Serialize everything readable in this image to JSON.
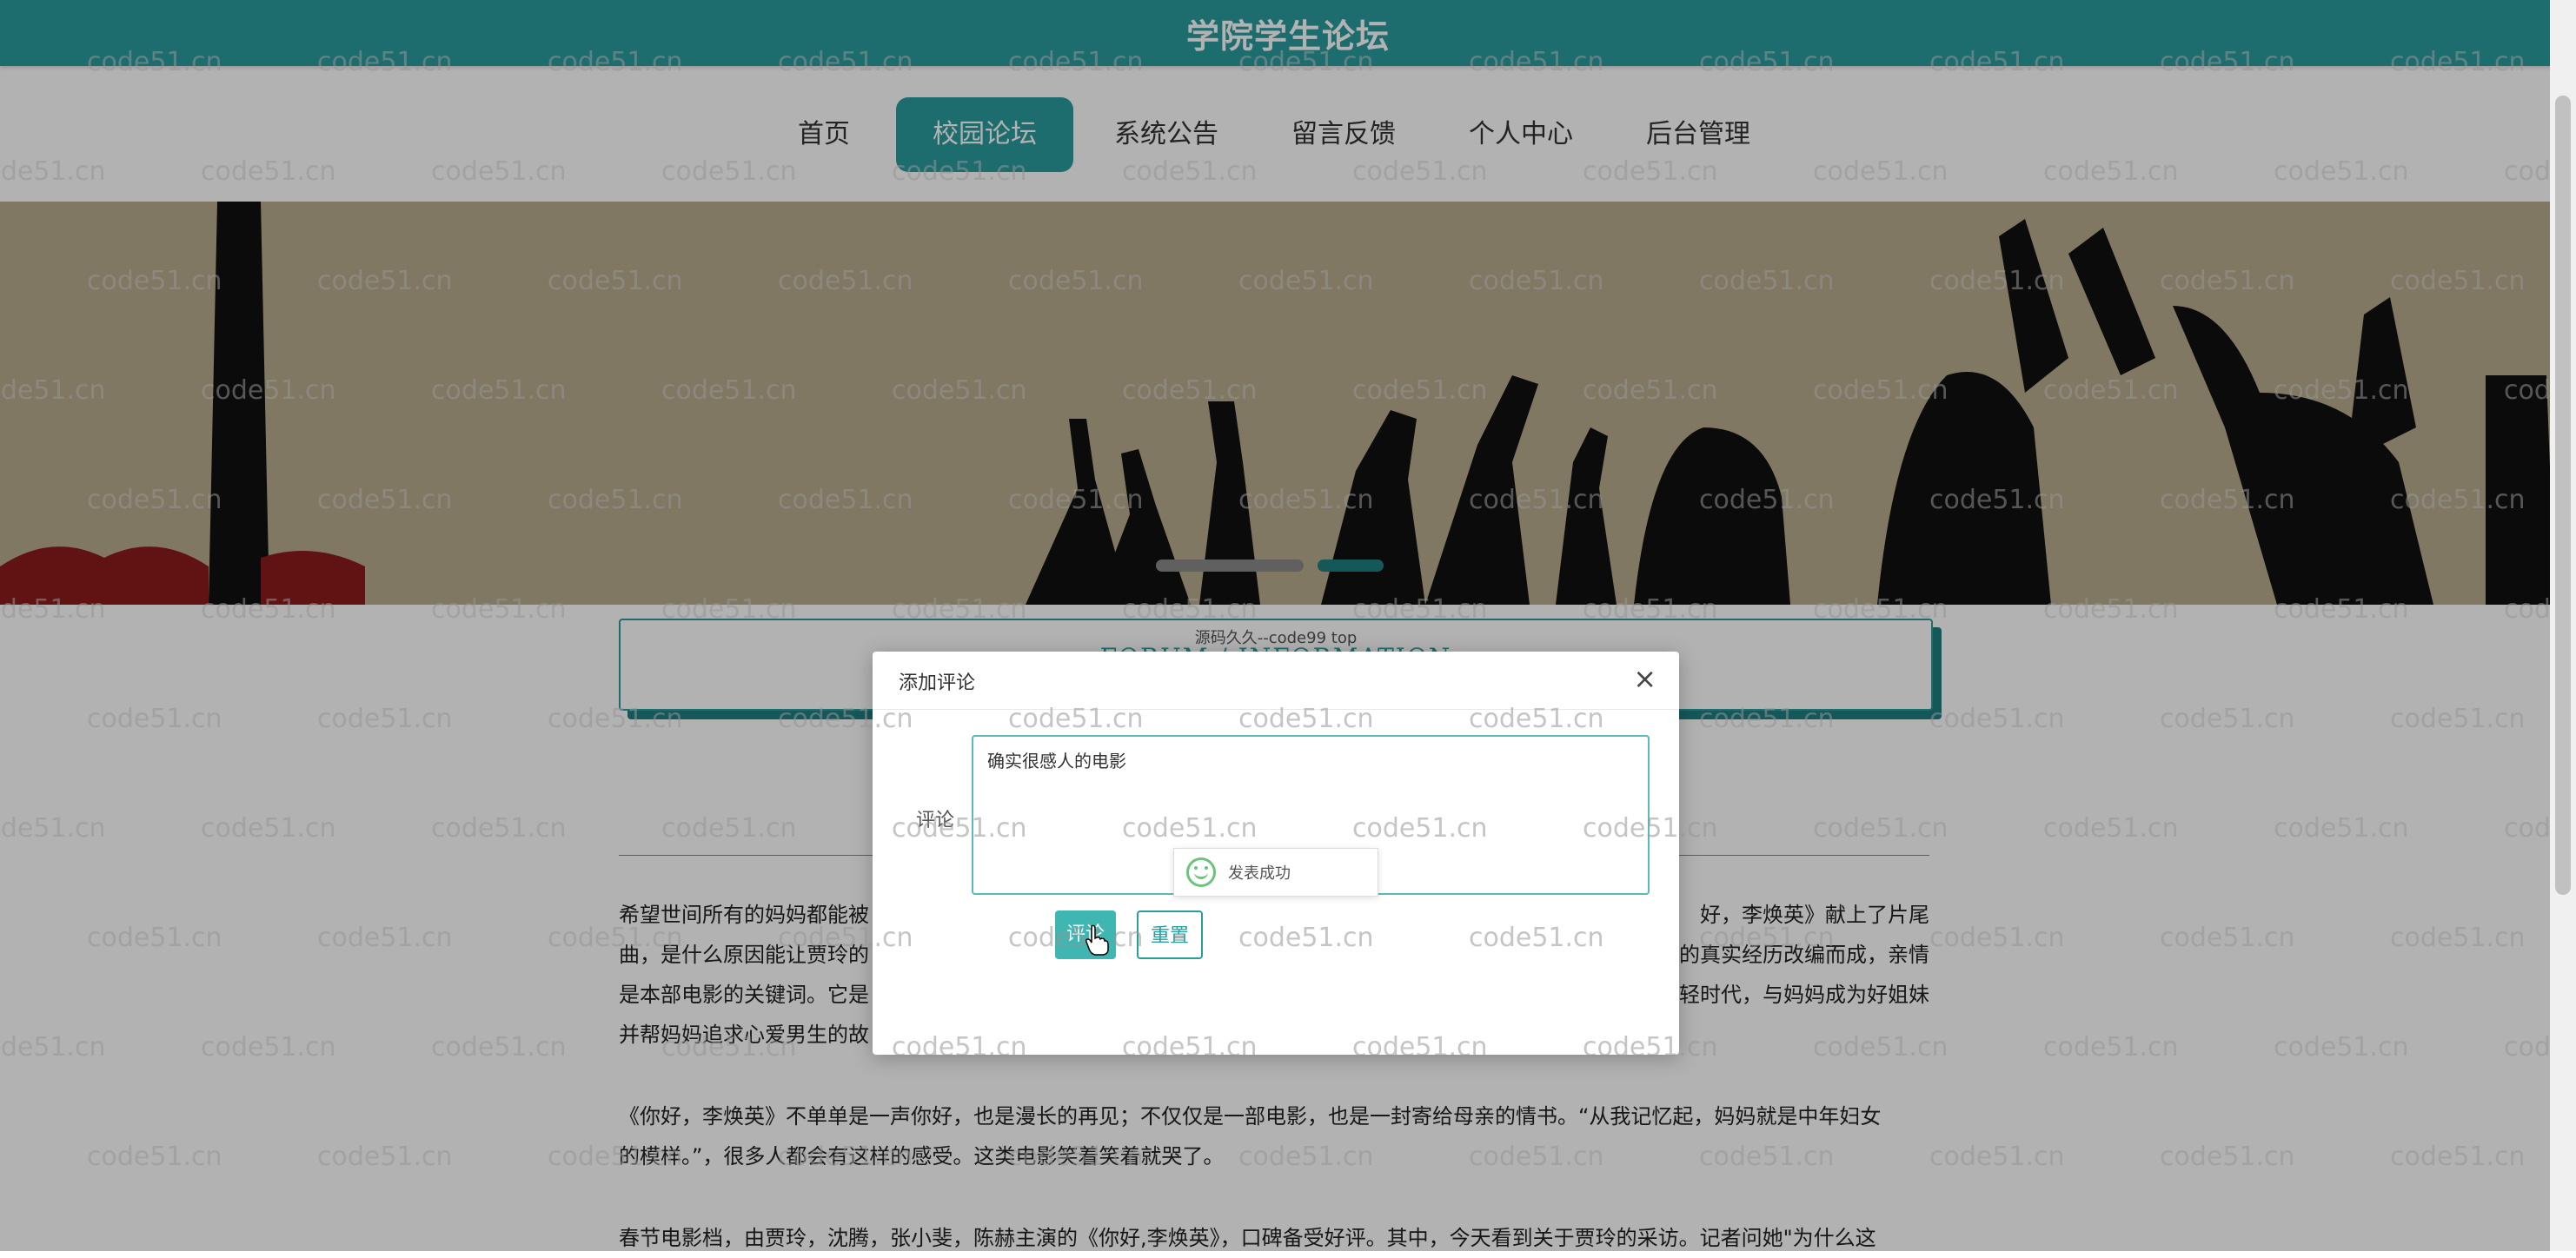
{
  "header": {
    "title": "学院学生论坛"
  },
  "nav": {
    "items": [
      "首页",
      "校园论坛",
      "系统公告",
      "留言反馈",
      "个人中心",
      "后台管理"
    ],
    "active": "校园论坛"
  },
  "forum_box": {
    "subtitle": "源码久久--code99 top",
    "title": "FORUM / INFORMATION"
  },
  "article": {
    "p1": [
      "希望世间所有的妈妈都能被",
      "好，李焕英》献上了片尾",
      "曲，是什么原因能让贾玲的",
      "的真实经历改编而成，亲情",
      "是本部电影的关键词。它是",
      "轻时代，与妈妈成为好姐妹",
      "并帮妈妈追求心爱男生的故"
    ],
    "p2_line1": "《你好，李焕英》不单单是一声你好，也是漫长的再见；不仅仅是一部电影，也是一封寄给母亲的情书。“从我记忆起，妈妈就是中年妇女",
    "p2_line2": "的模样。”，很多人都会有这样的感受。这类电影笑着笑着就哭了。",
    "p3_line1": "春节电影档，由贾玲，沈腾，张小斐，陈赫主演的《你好,李焕英》，口碑备受好评。其中，今天看到关于贾玲的采访。记者问她\"为什么这"
  },
  "dialog": {
    "title": "添加评论",
    "close": "×",
    "comment_label": "评论",
    "comment_value": "确实很感人的电影",
    "submit_label": "评论",
    "reset_label": "重置",
    "toast": "发表成功"
  },
  "watermark": {
    "text": "code51.cn"
  },
  "colors": {
    "primary": "#2a9d9f",
    "banner_bg": "#b8ad8f",
    "success": "#6bc47a"
  },
  "icons": {
    "close": "close-icon",
    "toast": "smile-icon",
    "cursor": "hand-cursor-icon"
  }
}
